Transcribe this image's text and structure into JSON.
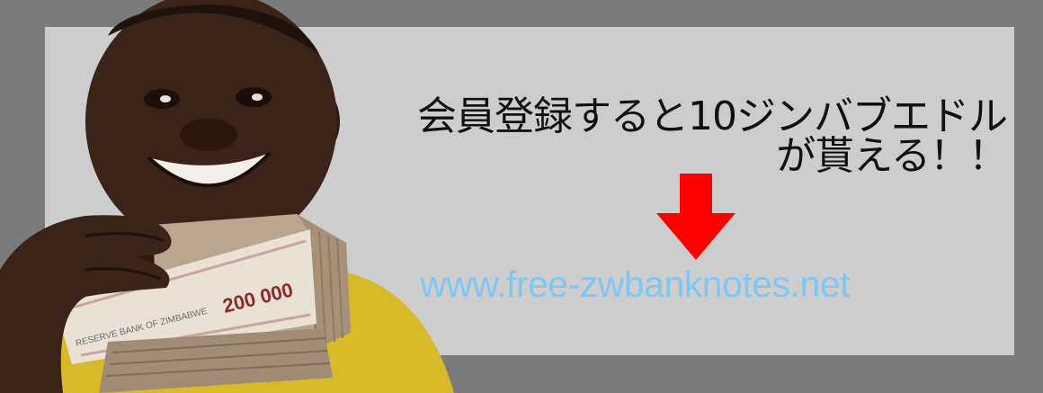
{
  "banner": {
    "headline_line1": "会員登録すると10ジンバブエドル",
    "headline_line2": "が貰える！！",
    "url": "www.free-zwbanknotes.net",
    "banknote_denomination": "200 000",
    "banknote_bank_name": "RESERVE BANK OF ZIMBABWE",
    "arrow_icon": "down-arrow-icon",
    "colors": {
      "page_background": "#7b7b7b",
      "banner_background": "#cdcdcd",
      "headline_text": "#111111",
      "arrow": "#ff0000",
      "url_text": "#7fc6f2"
    }
  }
}
